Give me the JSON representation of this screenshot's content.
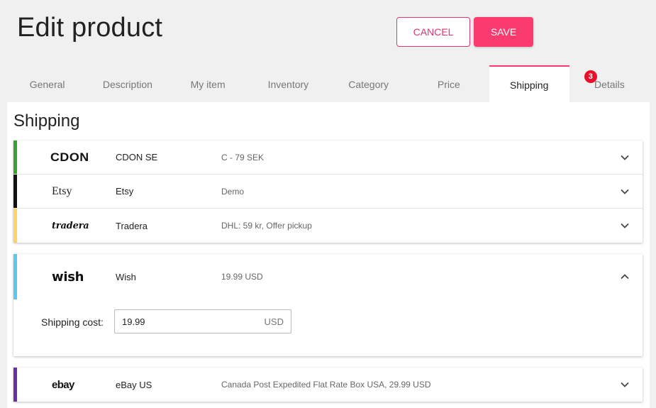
{
  "page": {
    "title": "Edit product"
  },
  "actions": {
    "cancel_label": "CANCEL",
    "save_label": "SAVE"
  },
  "tabs": [
    {
      "label": "General"
    },
    {
      "label": "Description"
    },
    {
      "label": "My item"
    },
    {
      "label": "Inventory"
    },
    {
      "label": "Category"
    },
    {
      "label": "Price"
    },
    {
      "label": "Shipping",
      "active": true
    },
    {
      "label": "Details",
      "badge": "3"
    }
  ],
  "shipping": {
    "title": "Shipping",
    "channels": [
      {
        "logo": "CDON",
        "name": "CDON SE",
        "summary": "C - 79 SEK",
        "color": "#3aa02f",
        "chevron": "chevron-down-icon"
      },
      {
        "logo": "Etsy",
        "name": "Etsy",
        "summary": "Demo",
        "color": "#111111",
        "chevron": "chevron-down-icon"
      },
      {
        "logo": "tradera",
        "name": "Tradera",
        "summary": "DHL: 59 kr, Offer pickup",
        "color": "#ffd166",
        "chevron": "chevron-down-icon"
      },
      {
        "logo": "wish",
        "name": "Wish",
        "summary": "19.99 USD",
        "color": "#5ec7ea",
        "chevron": "chevron-up-icon",
        "expanded": true,
        "cost_label": "Shipping cost:",
        "cost_value": "19.99",
        "cost_unit": "USD"
      },
      {
        "logo": "ebay",
        "name": "eBay US",
        "summary": "Canada Post Expedited Flat Rate Box USA, 29.99 USD",
        "color": "#6b2fa3",
        "chevron": "chevron-down-icon"
      }
    ]
  },
  "colors": {
    "accent": "#f93b6f",
    "badge": "#e8102a"
  }
}
